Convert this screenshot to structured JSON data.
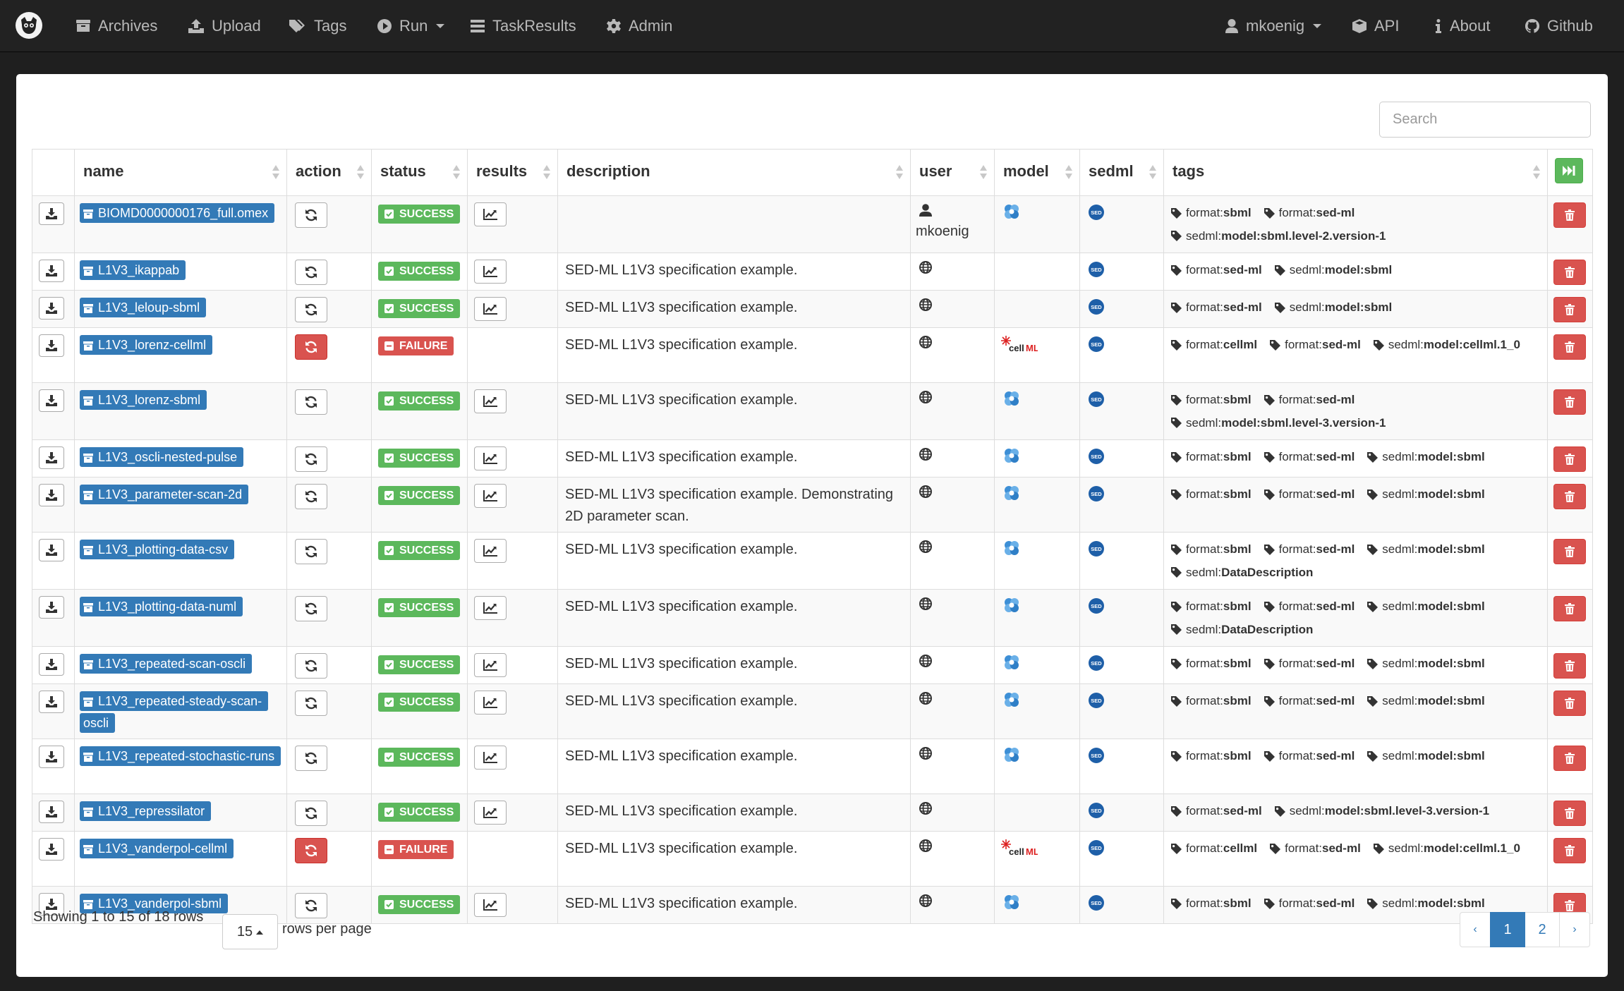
{
  "navbar": {
    "left": [
      {
        "label": "Archives",
        "icon": "archive-icon"
      },
      {
        "label": "Upload",
        "icon": "upload-icon"
      },
      {
        "label": "Tags",
        "icon": "tags-icon"
      },
      {
        "label": "Run",
        "icon": "play-circle-icon",
        "dropdown": true
      },
      {
        "label": "TaskResults",
        "icon": "list-icon"
      },
      {
        "label": "Admin",
        "icon": "gear-icon"
      }
    ],
    "right": [
      {
        "label": "mkoenig",
        "icon": "user-icon",
        "dropdown": true
      },
      {
        "label": "API",
        "icon": "cube-icon"
      },
      {
        "label": "About",
        "icon": "info-icon"
      },
      {
        "label": "Github",
        "icon": "github-icon"
      }
    ]
  },
  "search": {
    "placeholder": "Search"
  },
  "table": {
    "columns": [
      "name",
      "action",
      "status",
      "results",
      "description",
      "user",
      "model",
      "sedml",
      "tags"
    ],
    "rows": [
      {
        "name": "BIOMD0000000176_full.omex",
        "status": "SUCCESS",
        "description": "",
        "user": "mkoenig",
        "user_type": "person",
        "model": "sbml",
        "tags": [
          {
            "p": "format:",
            "v": "sbml"
          },
          {
            "p": "format:",
            "v": "sed-ml"
          },
          {
            "p": "sedml:",
            "v": "model:sbml.level-2.version-1"
          }
        ]
      },
      {
        "name": "L1V3_ikappab",
        "status": "SUCCESS",
        "description": "SED-ML L1V3 specification example.",
        "user": "",
        "user_type": "globe",
        "model": "",
        "tags": [
          {
            "p": "format:",
            "v": "sed-ml"
          },
          {
            "p": "sedml:",
            "v": "model:sbml"
          }
        ]
      },
      {
        "name": "L1V3_leloup-sbml",
        "status": "SUCCESS",
        "description": "SED-ML L1V3 specification example.",
        "user": "",
        "user_type": "globe",
        "model": "",
        "tags": [
          {
            "p": "format:",
            "v": "sed-ml"
          },
          {
            "p": "sedml:",
            "v": "model:sbml"
          }
        ]
      },
      {
        "name": "L1V3_lorenz-cellml",
        "status": "FAILURE",
        "description": "SED-ML L1V3 specification example.",
        "user": "",
        "user_type": "globe",
        "model": "cellml",
        "tags": [
          {
            "p": "format:",
            "v": "cellml"
          },
          {
            "p": "format:",
            "v": "sed-ml"
          },
          {
            "p": "sedml:",
            "v": "model:cellml.1_0"
          }
        ]
      },
      {
        "name": "L1V3_lorenz-sbml",
        "status": "SUCCESS",
        "description": "SED-ML L1V3 specification example.",
        "user": "",
        "user_type": "globe",
        "model": "sbml",
        "tags": [
          {
            "p": "format:",
            "v": "sbml"
          },
          {
            "p": "format:",
            "v": "sed-ml"
          },
          {
            "p": "sedml:",
            "v": "model:sbml.level-3.version-1"
          }
        ]
      },
      {
        "name": "L1V3_oscli-nested-pulse",
        "status": "SUCCESS",
        "description": "SED-ML L1V3 specification example.",
        "user": "",
        "user_type": "globe",
        "model": "sbml",
        "tags": [
          {
            "p": "format:",
            "v": "sbml"
          },
          {
            "p": "format:",
            "v": "sed-ml"
          },
          {
            "p": "sedml:",
            "v": "model:sbml"
          }
        ]
      },
      {
        "name": "L1V3_parameter-scan-2d",
        "status": "SUCCESS",
        "description": "SED-ML L1V3 specification example. Demonstrating 2D parameter scan.",
        "user": "",
        "user_type": "globe",
        "model": "sbml",
        "tags": [
          {
            "p": "format:",
            "v": "sbml"
          },
          {
            "p": "format:",
            "v": "sed-ml"
          },
          {
            "p": "sedml:",
            "v": "model:sbml"
          }
        ]
      },
      {
        "name": "L1V3_plotting-data-csv",
        "status": "SUCCESS",
        "description": "SED-ML L1V3 specification example.",
        "user": "",
        "user_type": "globe",
        "model": "sbml",
        "tags": [
          {
            "p": "format:",
            "v": "sbml"
          },
          {
            "p": "format:",
            "v": "sed-ml"
          },
          {
            "p": "sedml:",
            "v": "model:sbml"
          },
          {
            "p": "sedml:",
            "v": "DataDescription"
          }
        ]
      },
      {
        "name": "L1V3_plotting-data-numl",
        "status": "SUCCESS",
        "description": "SED-ML L1V3 specification example.",
        "user": "",
        "user_type": "globe",
        "model": "sbml",
        "tags": [
          {
            "p": "format:",
            "v": "sbml"
          },
          {
            "p": "format:",
            "v": "sed-ml"
          },
          {
            "p": "sedml:",
            "v": "model:sbml"
          },
          {
            "p": "sedml:",
            "v": "DataDescription"
          }
        ]
      },
      {
        "name": "L1V3_repeated-scan-oscli",
        "status": "SUCCESS",
        "description": "SED-ML L1V3 specification example.",
        "user": "",
        "user_type": "globe",
        "model": "sbml",
        "tags": [
          {
            "p": "format:",
            "v": "sbml"
          },
          {
            "p": "format:",
            "v": "sed-ml"
          },
          {
            "p": "sedml:",
            "v": "model:sbml"
          }
        ]
      },
      {
        "name": "L1V3_repeated-steady-scan-oscli",
        "status": "SUCCESS",
        "description": "SED-ML L1V3 specification example.",
        "user": "",
        "user_type": "globe",
        "model": "sbml",
        "tags": [
          {
            "p": "format:",
            "v": "sbml"
          },
          {
            "p": "format:",
            "v": "sed-ml"
          },
          {
            "p": "sedml:",
            "v": "model:sbml"
          }
        ]
      },
      {
        "name": "L1V3_repeated-stochastic-runs",
        "status": "SUCCESS",
        "description": "SED-ML L1V3 specification example.",
        "user": "",
        "user_type": "globe",
        "model": "sbml",
        "tags": [
          {
            "p": "format:",
            "v": "sbml"
          },
          {
            "p": "format:",
            "v": "sed-ml"
          },
          {
            "p": "sedml:",
            "v": "model:sbml"
          }
        ]
      },
      {
        "name": "L1V3_repressilator",
        "status": "SUCCESS",
        "description": "SED-ML L1V3 specification example.",
        "user": "",
        "user_type": "globe",
        "model": "",
        "tags": [
          {
            "p": "format:",
            "v": "sed-ml"
          },
          {
            "p": "sedml:",
            "v": "model:sbml.level-3.version-1"
          }
        ]
      },
      {
        "name": "L1V3_vanderpol-cellml",
        "status": "FAILURE",
        "description": "SED-ML L1V3 specification example.",
        "user": "",
        "user_type": "globe",
        "model": "cellml",
        "tags": [
          {
            "p": "format:",
            "v": "cellml"
          },
          {
            "p": "format:",
            "v": "sed-ml"
          },
          {
            "p": "sedml:",
            "v": "model:cellml.1_0"
          }
        ]
      },
      {
        "name": "L1V3_vanderpol-sbml",
        "status": "SUCCESS",
        "description": "SED-ML L1V3 specification example.",
        "user": "",
        "user_type": "globe",
        "model": "sbml",
        "tags": [
          {
            "p": "format:",
            "v": "sbml"
          },
          {
            "p": "format:",
            "v": "sed-ml"
          },
          {
            "p": "sedml:",
            "v": "model:sbml"
          }
        ]
      }
    ]
  },
  "footer": {
    "showing": "Showing 1 to 15 of 18 rows",
    "per_page": "15",
    "rows_per_page": "rows per page",
    "pages": [
      "1",
      "2"
    ],
    "active_page": "1",
    "prev": "‹",
    "next": "›"
  },
  "colors": {
    "primary": "#337ab7",
    "success": "#5cb85c",
    "danger": "#d9534f",
    "navbar": "#222222"
  }
}
